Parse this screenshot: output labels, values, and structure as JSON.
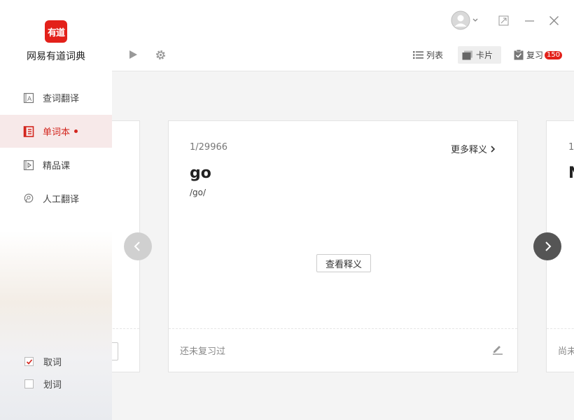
{
  "app": {
    "logo_text": "有道",
    "name": "网易有道词典"
  },
  "sidebar": {
    "items": [
      {
        "label": "查词翻译",
        "icon": "dictionary-icon"
      },
      {
        "label": "单词本",
        "icon": "wordbook-icon",
        "active": true,
        "has_dot": true
      },
      {
        "label": "精品课",
        "icon": "course-play-icon"
      },
      {
        "label": "人工翻译",
        "icon": "human-translation-icon"
      }
    ],
    "options": [
      {
        "label": "取词",
        "checked": true
      },
      {
        "label": "划词",
        "checked": false
      }
    ]
  },
  "toolbar": {
    "list_label": "列表",
    "card_label": "卡片",
    "review_label": "复习",
    "review_count": "150"
  },
  "card": {
    "counter": "1/29966",
    "more_label": "更多释义",
    "word": "go",
    "phonetic": "/go/",
    "view_def_label": "查看释义",
    "status": "还未复习过"
  },
  "next_card": {
    "counter_partial": "1",
    "word_partial": "N",
    "status_partial": "尚未"
  },
  "colors": {
    "accent": "#e3211a",
    "active_bg": "#f7e9e9"
  }
}
